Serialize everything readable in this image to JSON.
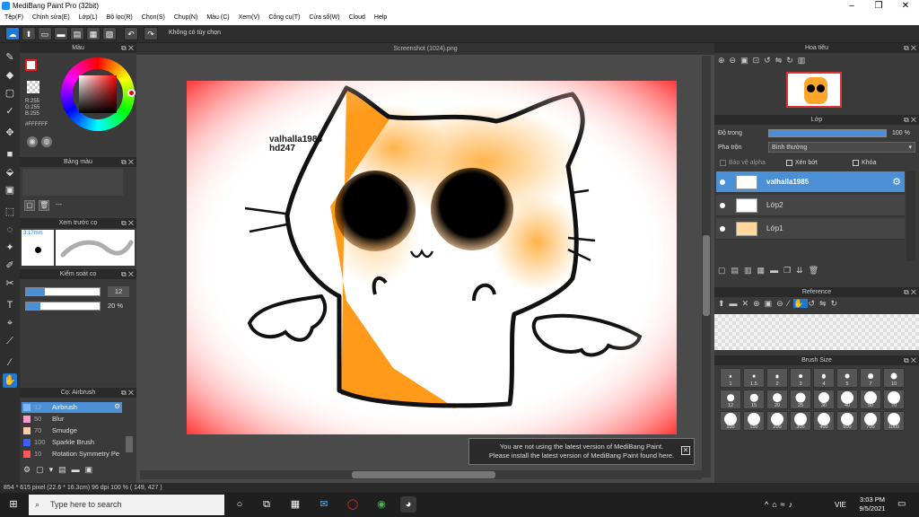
{
  "window": {
    "title": "MediBang Paint Pro (32bit)"
  },
  "menu": [
    "Tệp(F)",
    "Chỉnh sửa(E)",
    "Lớp(L)",
    "Bộ lọc(R)",
    "Chọn(S)",
    "Chụp(N)",
    "Màu (C)",
    "Xem(V)",
    "Công cụ(T)",
    "Cửa sổ(W)",
    "Cloud",
    "Help"
  ],
  "toolbar": {
    "note": "Không có tùy chọn"
  },
  "color_panel": {
    "title": "Màu",
    "r": "R:255",
    "g": "G:255",
    "b": "B:255",
    "hex": "#FFFFFF"
  },
  "palette_panel": {
    "title": "Bảng màu",
    "dash": "---"
  },
  "brush_preview": {
    "title": "Xem trước cọ",
    "size": "3.17mm"
  },
  "brush_control": {
    "title": "Kiểm soát cọ",
    "size_value": "12",
    "opacity_value": "20 %",
    "size_fill": 0.25,
    "opacity_fill": 0.2
  },
  "brush_list": {
    "title": "Cọ: Airbrush",
    "items": [
      {
        "num": "12",
        "label": "Airbrush",
        "color": "#7fb7ff"
      },
      {
        "num": "50",
        "label": "Blur",
        "color": "#ff99cc"
      },
      {
        "num": "70",
        "label": "Smudge",
        "color": "#ffccaa"
      },
      {
        "num": "100",
        "label": "Sparkle Brush",
        "color": "#3a5fff"
      },
      {
        "num": "10",
        "label": "Rotation Symmetry Pe",
        "color": "#ff5555"
      }
    ]
  },
  "canvas": {
    "tab": "Screenshot (1024).png",
    "watermark1": "valhalla1985",
    "watermark2": "hd247"
  },
  "notice": {
    "line1": "You are not using the latest version of MediBang Paint.",
    "line2": "Please install the latest version of MediBang Paint found here."
  },
  "navigator": {
    "title": "Hoa tiêu"
  },
  "layers_panel": {
    "title": "Lớp",
    "opacity_label": "Độ trong",
    "opacity_value": "100 %",
    "opacity_fill": 1.0,
    "blend_label": "Pha trộn",
    "blend_value": "Bình thường",
    "alpha_label": "Bảo vệ alpha",
    "clip_label": "Xén bớt",
    "lock_label": "Khóa",
    "layers": [
      "valhalla1985",
      "Lớp2",
      "Lớp1"
    ]
  },
  "reference": {
    "title": "Reference"
  },
  "brush_size": {
    "title": "Brush Size",
    "sizes": [
      "1",
      "1.5",
      "2",
      "3",
      "4",
      "5",
      "7",
      "10",
      "12",
      "15",
      "20",
      "25",
      "30",
      "40",
      "50",
      "70",
      "100",
      "150",
      "200",
      "300",
      "400",
      "500",
      "700",
      "1000"
    ]
  },
  "status": {
    "text": "854 * 615 pixel   (22.6 * 16.3cm)   96 dpi   100 %   ( 149, 427 )"
  },
  "taskbar": {
    "search_placeholder": "Type here to search",
    "time": "3:03 PM",
    "date": "9/5/2021",
    "lang": "VIE"
  }
}
